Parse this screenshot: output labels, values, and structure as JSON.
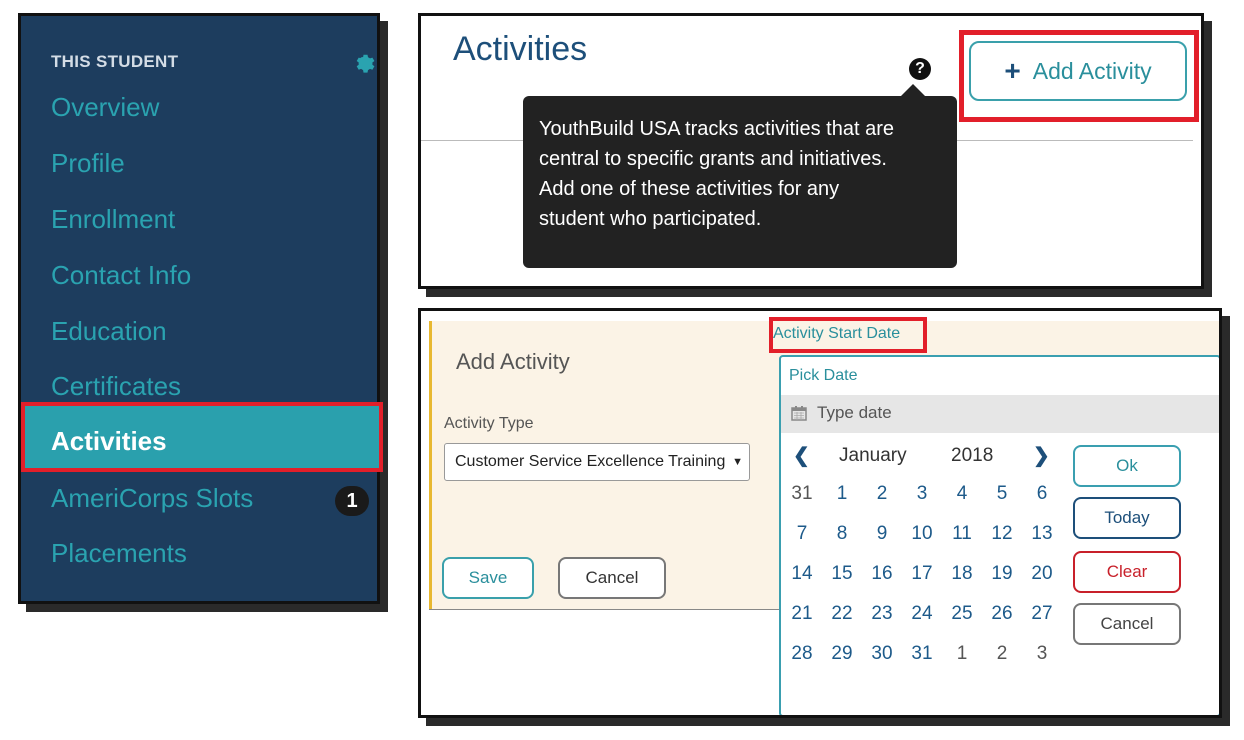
{
  "sidebar": {
    "section_title": "THIS STUDENT",
    "items": [
      {
        "label": "Overview"
      },
      {
        "label": "Profile"
      },
      {
        "label": "Enrollment"
      },
      {
        "label": "Contact Info"
      },
      {
        "label": "Education"
      },
      {
        "label": "Certificates"
      },
      {
        "label": "Activities",
        "active": true
      },
      {
        "label": "AmeriCorps Slots",
        "badge": "1"
      },
      {
        "label": "Placements"
      }
    ]
  },
  "header": {
    "title": "Activities",
    "help_icon": "?",
    "add_button": {
      "icon": "+",
      "label": "Add Activity"
    },
    "tooltip": {
      "lines": [
        "YouthBuild USA tracks activities that are",
        "central to specific grants and initiatives.",
        "Add one of these activities for any",
        "student who participated."
      ]
    }
  },
  "form": {
    "title": "Add Activity",
    "activity_type_label": "Activity Type",
    "activity_type_value": "Customer Service Excellence Training",
    "save_label": "Save",
    "cancel_label": "Cancel",
    "start_date_label": "Activity Start Date"
  },
  "datepicker": {
    "pick_title": "Pick Date",
    "input_placeholder": "Type date",
    "month": "January",
    "year": "2018",
    "prev": "❮",
    "next": "❯",
    "weeks": [
      [
        "31",
        "1",
        "2",
        "3",
        "4",
        "5",
        "6"
      ],
      [
        "7",
        "8",
        "9",
        "10",
        "11",
        "12",
        "13"
      ],
      [
        "14",
        "15",
        "16",
        "17",
        "18",
        "19",
        "20"
      ],
      [
        "21",
        "22",
        "23",
        "24",
        "25",
        "26",
        "27"
      ],
      [
        "28",
        "29",
        "30",
        "31",
        "1",
        "2",
        "3"
      ]
    ],
    "buttons": {
      "ok": "Ok",
      "today": "Today",
      "clear": "Clear",
      "cancel": "Cancel"
    },
    "colors": {
      "ok": "#3a9fb0",
      "today": "#1d4f7a",
      "clear": "#c8202a",
      "cancel": "#777777"
    }
  }
}
